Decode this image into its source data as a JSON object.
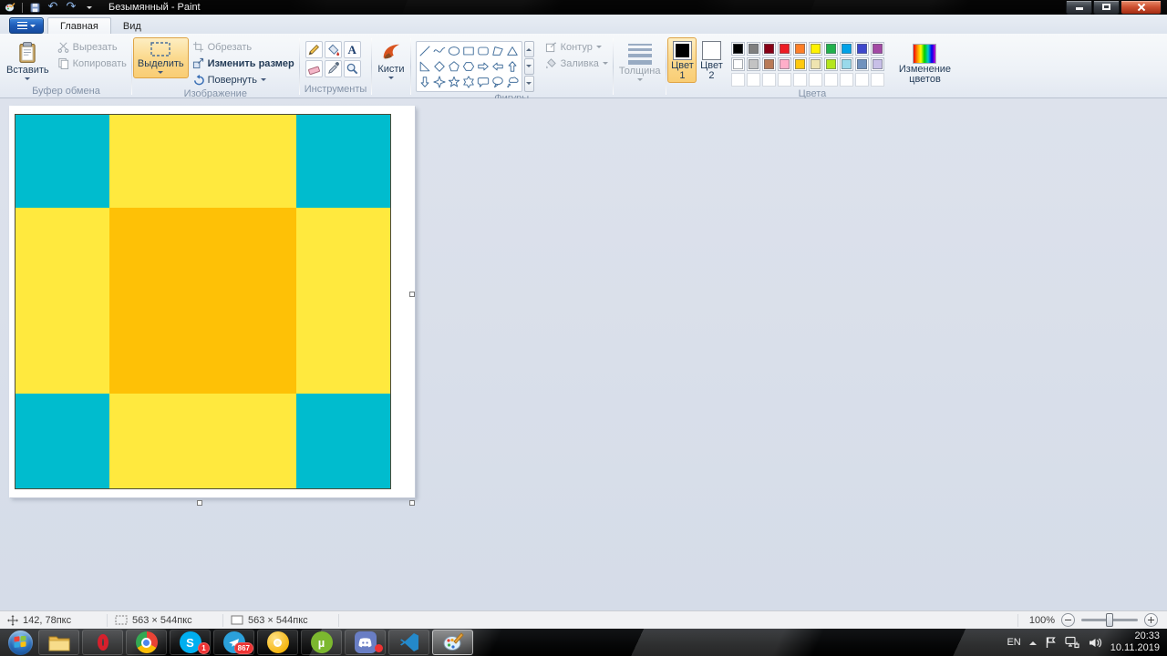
{
  "titlebar": {
    "title": "Безымянный - Paint"
  },
  "tabs": {
    "home": "Главная",
    "view": "Вид"
  },
  "ribbon": {
    "clipboard": {
      "group_label": "Буфер обмена",
      "paste": "Вставить",
      "cut": "Вырезать",
      "copy": "Копировать"
    },
    "image": {
      "group_label": "Изображение",
      "select": "Выделить",
      "crop": "Обрезать",
      "resize": "Изменить размер",
      "rotate": "Повернуть"
    },
    "tools": {
      "group_label": "Инструменты",
      "text_tool": "A"
    },
    "brushes": {
      "label": "Кисти"
    },
    "shapes": {
      "group_label": "Фигуры",
      "outline": "Контур",
      "fill": "Заливка",
      "items": [
        "line",
        "curve",
        "oval",
        "rectangle",
        "rounded-rectangle",
        "polygon",
        "triangle",
        "right-triangle",
        "diamond",
        "pentagon",
        "hexagon",
        "arrow-right",
        "arrow-left",
        "arrow-up",
        "arrow-down",
        "star-4",
        "star-5",
        "star-6",
        "callout-rounded",
        "callout-oval",
        "callout-cloud"
      ]
    },
    "size": {
      "label": "Толщина"
    },
    "colors": {
      "group_label": "Цвета",
      "color1_label": "Цвет 1",
      "color2_label": "Цвет 2",
      "edit_label": "Изменение цветов",
      "color1": "#000000",
      "color2": "#ffffff",
      "palette": [
        [
          "#000000",
          "#7f7f7f",
          "#880015",
          "#ed1c24",
          "#ff7f27",
          "#fff200",
          "#22b14c",
          "#00a2e8",
          "#3f48cc",
          "#a349a4"
        ],
        [
          "#ffffff",
          "#c3c3c3",
          "#b97a57",
          "#ffaec9",
          "#ffc90e",
          "#efe4b0",
          "#b5e61d",
          "#99d9ea",
          "#7092be",
          "#c8bfe7"
        ],
        [
          "",
          "",
          "",
          "",
          "",
          "",
          "",
          "",
          "",
          ""
        ]
      ]
    }
  },
  "canvas": {
    "pattern": {
      "grid": [
        [
          "teal",
          "yellow",
          "teal"
        ],
        [
          "yellow",
          "orange",
          "yellow"
        ],
        [
          "teal",
          "yellow",
          "teal"
        ]
      ],
      "colors": {
        "teal": "#00bcce",
        "yellow": "#ffe93e",
        "orange": "#fec106"
      }
    }
  },
  "statusbar": {
    "cursor_pos": "142, 78пкс",
    "selection_size": "563 × 544пкс",
    "canvas_size": "563 × 544пкс",
    "zoom_level": "100%"
  },
  "taskbar": {
    "items": [
      {
        "name": "start"
      },
      {
        "name": "explorer"
      },
      {
        "name": "opera"
      },
      {
        "name": "chrome"
      },
      {
        "name": "skype",
        "badge": "1"
      },
      {
        "name": "telegram",
        "badge": "867"
      },
      {
        "name": "canary"
      },
      {
        "name": "utorrent"
      },
      {
        "name": "discord",
        "dot": true
      },
      {
        "name": "vscode"
      },
      {
        "name": "paint",
        "active": true
      }
    ],
    "tray": {
      "language": "EN",
      "time": "20:33",
      "date": "10.11.2019"
    }
  }
}
